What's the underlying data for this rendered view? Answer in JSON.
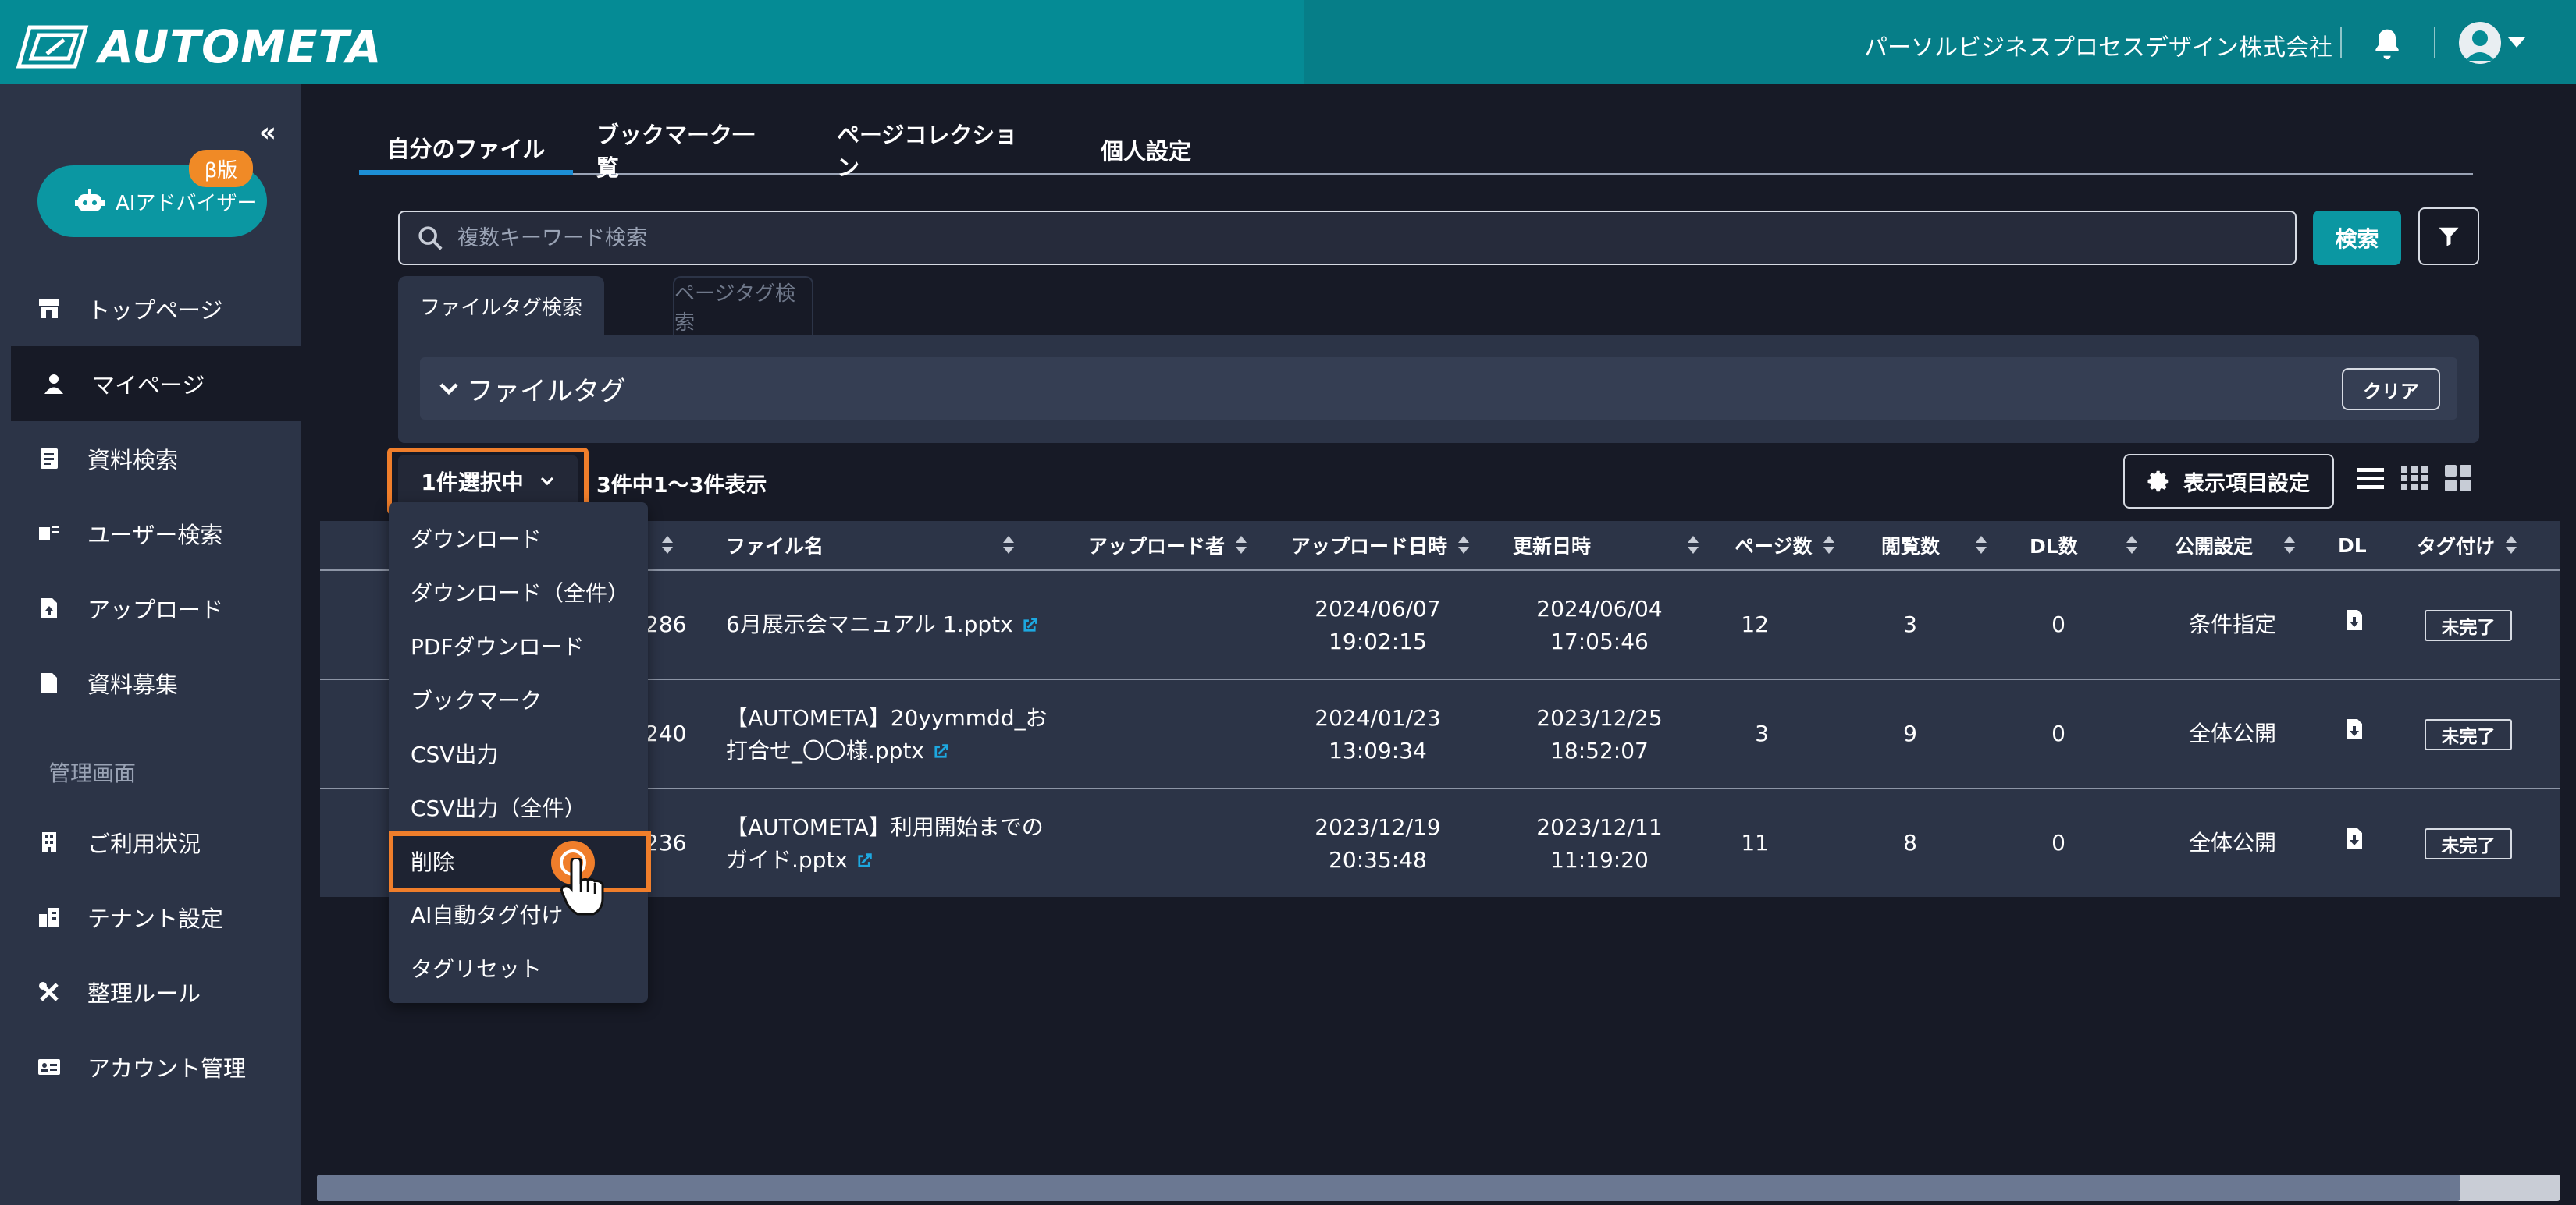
{
  "header": {
    "logo_text": "AUTOMETA",
    "company": "パーソルビジネスプロセスデザイン株式会社",
    "icons": [
      "logo-icon",
      "bell-icon",
      "user-avatar-icon",
      "caret-down-icon"
    ]
  },
  "sidebar": {
    "collapse": "«",
    "ai_button": "AIアドバイザー",
    "beta_badge": "β版",
    "items": [
      {
        "label": "トップページ",
        "icon": "store-icon"
      },
      {
        "label": "マイページ",
        "icon": "user-icon",
        "active": true
      },
      {
        "label": "資料検索",
        "icon": "document-search-icon"
      },
      {
        "label": "ユーザー検索",
        "icon": "user-search-icon"
      },
      {
        "label": "アップロード",
        "icon": "upload-icon"
      },
      {
        "label": "資料募集",
        "icon": "file-icon"
      }
    ],
    "admin_section": "管理画面",
    "admin_items": [
      {
        "label": "ご利用状況",
        "icon": "building-icon"
      },
      {
        "label": "テナント設定",
        "icon": "tenant-icon"
      },
      {
        "label": "整理ルール",
        "icon": "tools-icon"
      },
      {
        "label": "アカウント管理",
        "icon": "id-card-icon"
      }
    ]
  },
  "tabs": [
    "自分のファイル",
    "ブックマーク一覧",
    "ページコレクション",
    "個人設定"
  ],
  "search": {
    "placeholder": "複数キーワード検索",
    "button": "検索"
  },
  "tag_search": {
    "tabs": [
      "ファイルタグ検索",
      "ページタグ検索"
    ],
    "section_title": "ファイルタグ",
    "clear_button": "クリア"
  },
  "toolbar": {
    "selection_button": "1件選択中",
    "count_text": "3件中1～3件表示",
    "display_settings_button": "表示項目設定"
  },
  "dropdown": {
    "items": [
      "ダウンロード",
      "ダウンロード（全件）",
      "PDFダウンロード",
      "ブックマーク",
      "CSV出力",
      "CSV出力（全件）",
      "削除",
      "AI自動タグ付け",
      "タグリセット"
    ],
    "highlighted": "削除"
  },
  "table": {
    "headers": [
      "ファイル名",
      "アップロード者",
      "アップロード日時",
      "更新日時",
      "ページ数",
      "閲覧数",
      "DL数",
      "公開設定",
      "DL",
      "タグ付け"
    ],
    "rows": [
      {
        "id_partial": "286",
        "file_line1": "6月展示会マニュアル 1.pptx",
        "file_line2": "",
        "uploaded_date": "2024/06/07",
        "uploaded_time": "19:02:15",
        "updated_date": "2024/06/04",
        "updated_time": "17:05:46",
        "pages": "12",
        "views": "3",
        "dl_count": "0",
        "visibility": "条件指定",
        "tag_status": "未完了"
      },
      {
        "id_partial": "240",
        "file_line1": "【AUTOMETA】20yymmdd_お",
        "file_line2": "打合せ_〇〇様.pptx",
        "uploaded_date": "2024/01/23",
        "uploaded_time": "13:09:34",
        "updated_date": "2023/12/25",
        "updated_time": "18:52:07",
        "pages": "3",
        "views": "9",
        "dl_count": "0",
        "visibility": "全体公開",
        "tag_status": "未完了"
      },
      {
        "id_partial": "236",
        "file_line1": "【AUTOMETA】利用開始までの",
        "file_line2": "ガイド.pptx",
        "uploaded_date": "2023/12/19",
        "uploaded_time": "20:35:48",
        "updated_date": "2023/12/11",
        "updated_time": "11:19:20",
        "pages": "11",
        "views": "8",
        "dl_count": "0",
        "visibility": "全体公開",
        "tag_status": "未完了"
      }
    ]
  },
  "colors": {
    "header": "#058b95",
    "accent": "#0b97a2",
    "highlight": "#f07e2b",
    "background": "#171a26",
    "panel": "#2c3447",
    "link": "#1da8e0"
  }
}
